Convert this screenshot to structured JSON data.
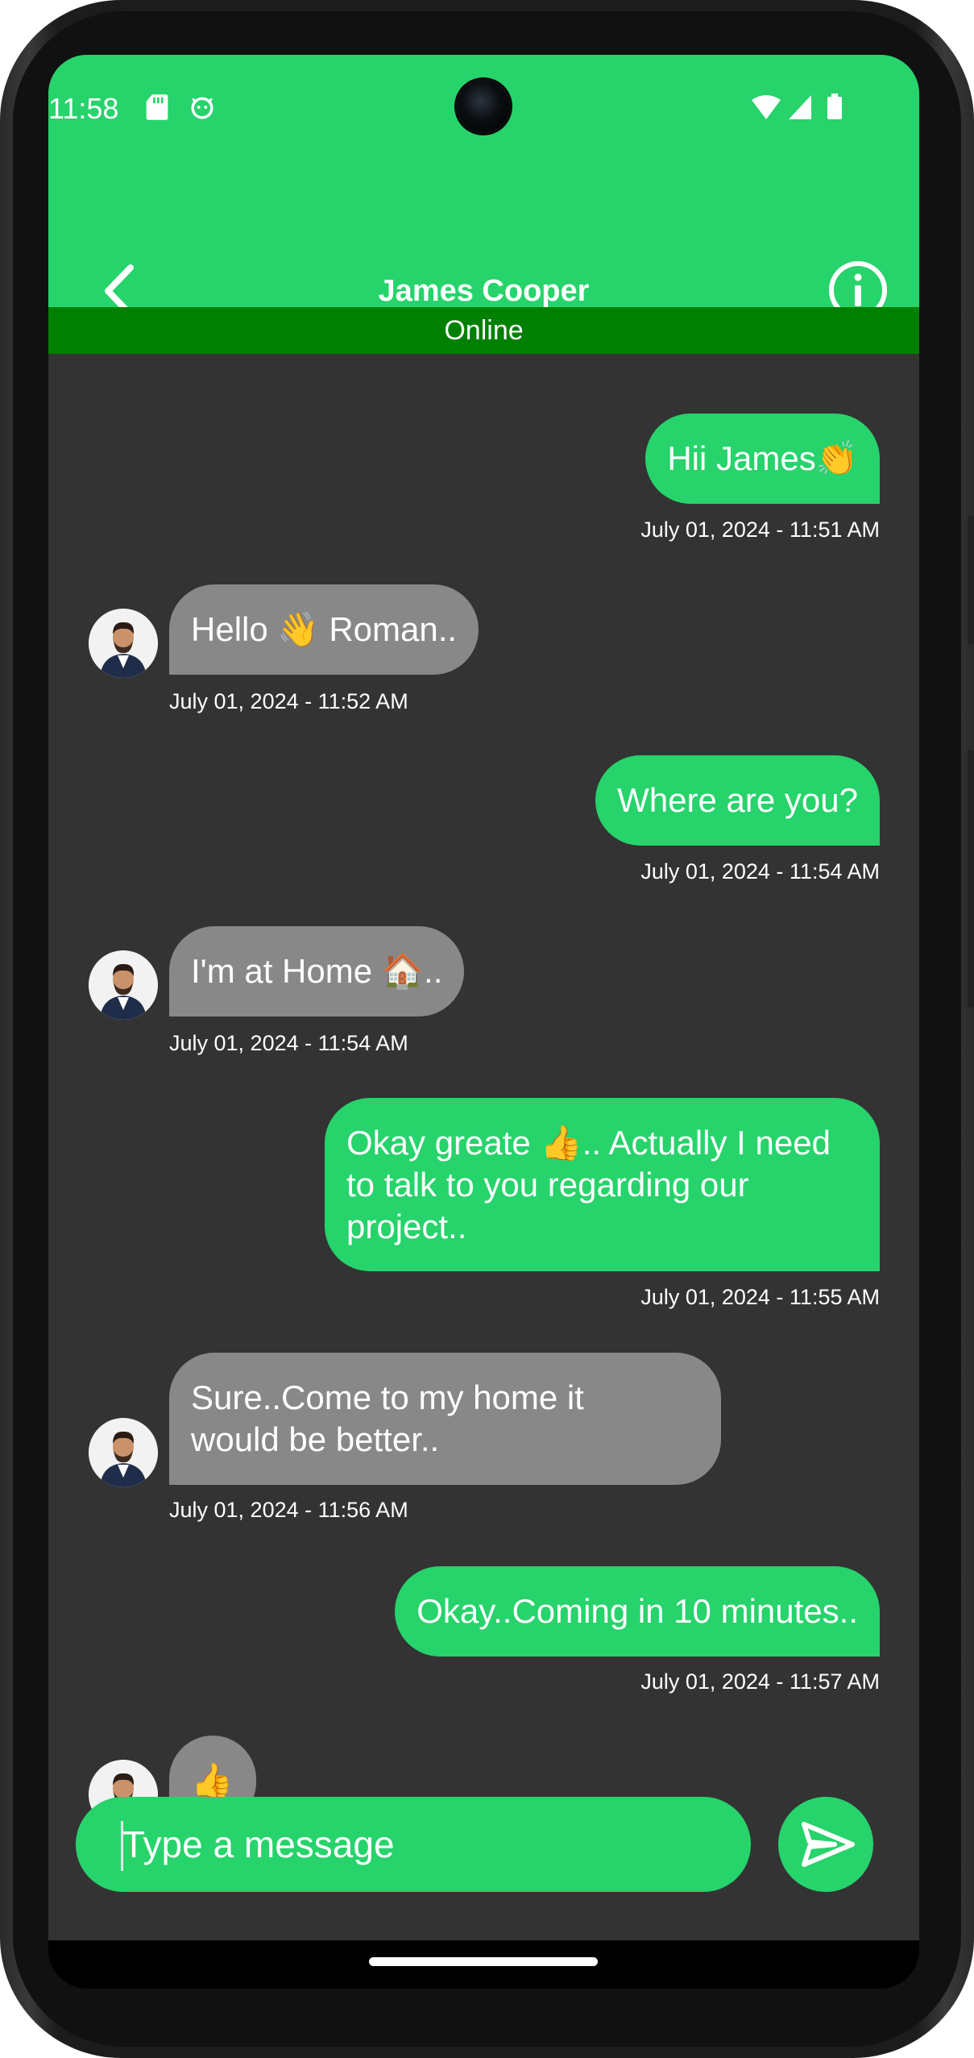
{
  "status_bar": {
    "time": "11:58",
    "icons": [
      "sd-card-icon",
      "android-icon",
      "wifi-icon",
      "cell-signal-icon",
      "battery-icon"
    ]
  },
  "header": {
    "title": "James Cooper",
    "status": "Online",
    "back_icon": "chevron-left-icon",
    "info_icon": "info-icon"
  },
  "colors": {
    "accent": "#27d36b",
    "online_bar": "#008000",
    "chat_bg": "#333333",
    "received_bubble": "#888888"
  },
  "messages": [
    {
      "side": "sent",
      "text": "Hii James👏",
      "time": "July 01, 2024 - 11:51 AM"
    },
    {
      "side": "received",
      "text": "Hello 👋 Roman..",
      "time": "July 01, 2024 - 11:52 AM"
    },
    {
      "side": "sent",
      "text": "Where are you?",
      "time": "July 01, 2024 - 11:54 AM"
    },
    {
      "side": "received",
      "text": "I'm at Home 🏠..",
      "time": "July 01, 2024 - 11:54 AM"
    },
    {
      "side": "sent",
      "text": "Okay greate 👍.. Actually I need to talk to you regarding our project..",
      "time": "July 01, 2024 - 11:55 AM"
    },
    {
      "side": "received",
      "text": "Sure..Come to my home it would be better..",
      "time": "July 01, 2024 - 11:56 AM"
    },
    {
      "side": "sent",
      "text": "Okay..Coming in 10 minutes..",
      "time": "July 01, 2024 - 11:57 AM"
    },
    {
      "side": "received",
      "text": "👍",
      "time": ""
    }
  ],
  "composer": {
    "placeholder": "Type a message",
    "send_icon": "send-icon"
  }
}
